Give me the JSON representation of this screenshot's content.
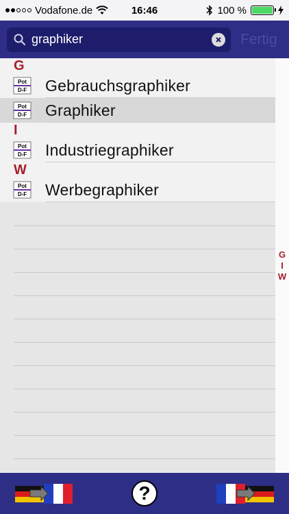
{
  "status_bar": {
    "carrier": "Vodafone.de",
    "time": "16:46",
    "battery_percent": "100 %",
    "signal_bars_filled": 2,
    "signal_bars_total": 5,
    "battery_level": 1.0
  },
  "search": {
    "value": "graphiker",
    "cancel_label": "Fertig"
  },
  "icon_labels": {
    "top": "Pot",
    "bottom": "D-F"
  },
  "sections": [
    {
      "letter": "G",
      "items": [
        {
          "label": "Gebrauchsgraphiker",
          "selected": false
        },
        {
          "label": "Graphiker",
          "selected": true
        }
      ]
    },
    {
      "letter": "I",
      "items": [
        {
          "label": "Industriegraphiker",
          "selected": false
        }
      ]
    },
    {
      "letter": "W",
      "items": [
        {
          "label": "Werbegraphiker",
          "selected": false
        }
      ]
    }
  ],
  "index": [
    "G",
    "I",
    "W"
  ],
  "colors": {
    "bar_blue": "#2e2e86",
    "section_red": "#a61e2c",
    "selected_row": "#d8d8d8"
  },
  "toolbar": {
    "left_icon": "german-to-french-flag-icon",
    "center_icon": "help-icon",
    "center_label": "?",
    "right_icon": "french-to-german-flag-icon"
  }
}
